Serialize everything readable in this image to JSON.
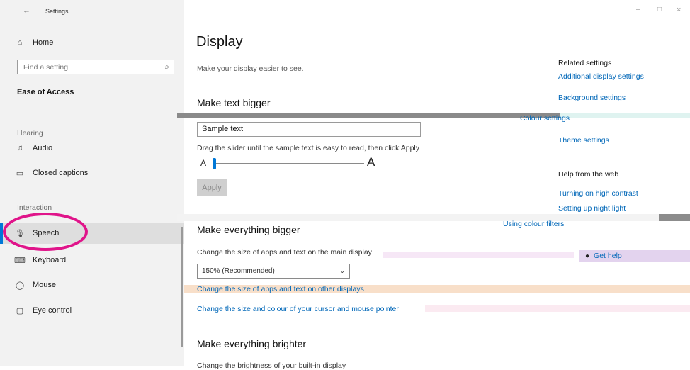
{
  "window": {
    "title": "Settings",
    "back_icon": "←",
    "minimize_icon": "–",
    "maximize_icon": "□",
    "close_icon": "×"
  },
  "sidebar": {
    "home_icon": "⌂",
    "home_label": "Home",
    "search_placeholder": "Find a setting",
    "search_icon": "⌕",
    "category_title": "Ease of Access",
    "section_hearing": "Hearing",
    "section_interaction": "Interaction",
    "items": [
      {
        "icon": "♫",
        "label": "Audio"
      },
      {
        "icon": "▭",
        "label": "Closed captions"
      },
      {
        "icon": "🎙",
        "label": "Speech"
      },
      {
        "icon": "⌨",
        "label": "Keyboard"
      },
      {
        "icon": "◯",
        "label": "Mouse"
      },
      {
        "icon": "▢",
        "label": "Eye control"
      }
    ]
  },
  "main": {
    "title": "Display",
    "subtitle": "Make your display easier to see.",
    "text_bigger": {
      "heading": "Make text bigger",
      "sample_text": "Sample text",
      "instruction": "Drag the slider until the sample text is easy to read, then click Apply",
      "slider_min_label": "A",
      "slider_max_label": "A",
      "slider_value": 0.0,
      "apply_label": "Apply"
    },
    "everything_bigger": {
      "heading": "Make everything bigger",
      "description": "Change the size of apps and text on the main display",
      "dropdown_value": "150% (Recommended)",
      "link_other_displays": "Change the size of apps and text on other displays",
      "link_cursor": "Change the size and colour of your cursor and mouse pointer"
    },
    "everything_brighter": {
      "heading": "Make everything brighter",
      "description": "Change the brightness of your built-in display"
    }
  },
  "related": {
    "title": "Related settings",
    "links": [
      "Additional display settings",
      "Background settings",
      "Colour settings",
      "Theme settings"
    ],
    "help_title": "Help from the web",
    "help_links": [
      "Turning on high contrast",
      "Setting up night light",
      "Using colour filters"
    ],
    "get_help_label": "Get help"
  },
  "colors": {
    "accent": "#0078d7",
    "link": "#0067b8",
    "annotation": "#e0148a",
    "sidebar_bg": "#f2f2f2"
  }
}
